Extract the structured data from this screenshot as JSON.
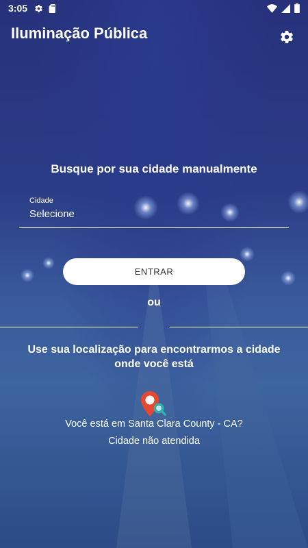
{
  "status_bar": {
    "time": "3:05"
  },
  "app_bar": {
    "title": "Iluminação Pública"
  },
  "manual": {
    "heading": "Busque por sua cidade manualmente",
    "city_label": "Cidade",
    "city_value": "Selecione",
    "enter_button": "ENTRAR"
  },
  "separator": {
    "or_label": "ou"
  },
  "location": {
    "heading": "Use sua localização para encontrarmos a cidade onde você está",
    "question": "Você está em Santa Clara County - CA?",
    "status": "Cidade não atendida"
  },
  "colors": {
    "background_top": "#26317a",
    "background_bottom": "#2c4a86",
    "pin_red": "#e8482f",
    "pin_teal": "#2bb3b1"
  },
  "icons": {
    "settings": "gear-icon",
    "location": "location-search-pin-icon"
  }
}
